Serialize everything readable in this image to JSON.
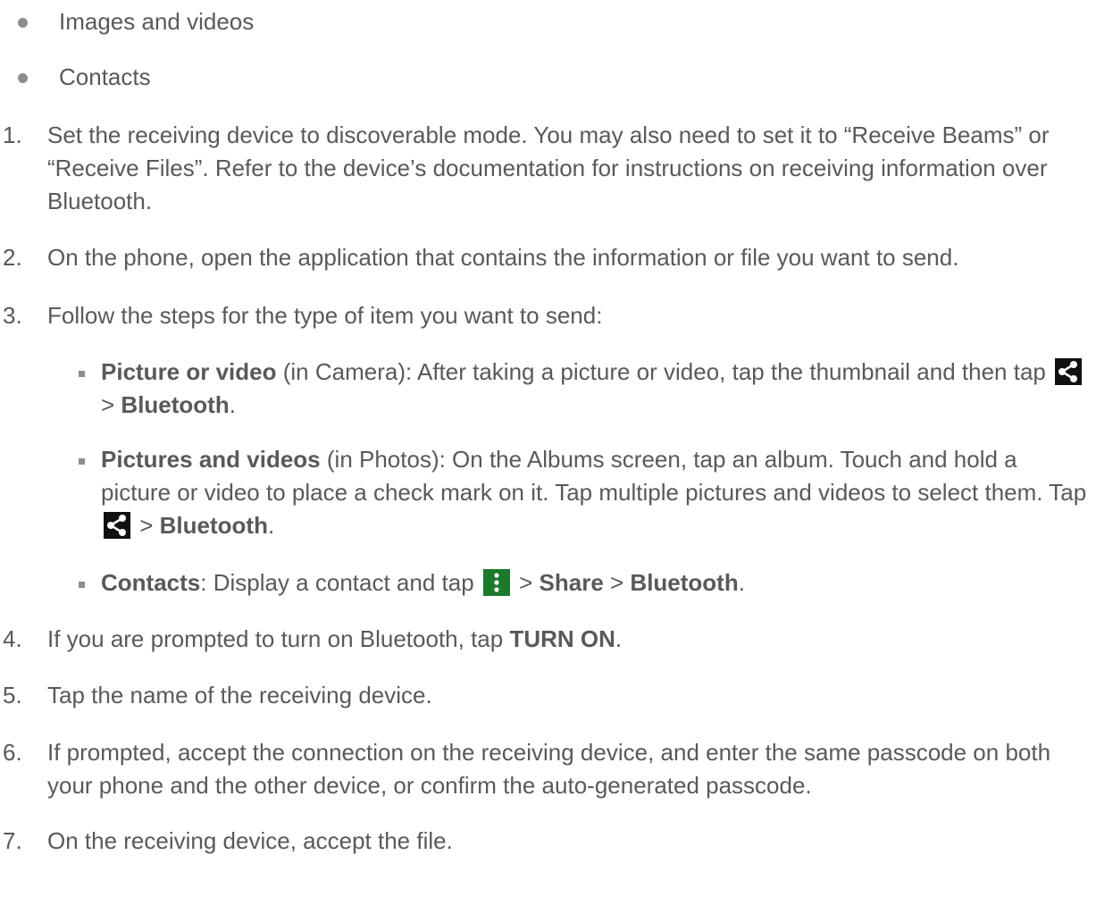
{
  "bullets": [
    "Images and videos",
    "Contacts"
  ],
  "steps": [
    {
      "num": "1.",
      "text": "Set the receiving device to discoverable mode. You may also need to set it to “Receive Beams” or “Receive Files”. Refer to the device’s documentation for instructions on receiving information over Bluetooth."
    },
    {
      "num": "2.",
      "text": "On the phone, open the application that contains the information or file you want to send."
    },
    {
      "num": "3.",
      "text": "Follow the steps for the type of item you want to send:"
    },
    {
      "num": "4.",
      "pre": "If you are prompted to turn on Bluetooth, tap ",
      "bold": "TURN ON",
      "post": "."
    },
    {
      "num": "5.",
      "text": "Tap the name of the receiving device."
    },
    {
      "num": "6.",
      "text": "If prompted, accept the connection on the receiving device, and enter the same passcode on both your phone and the other device, or confirm the auto-generated passcode."
    },
    {
      "num": "7.",
      "text": "On the receiving device, accept the file."
    }
  ],
  "subitems": {
    "picture": {
      "bold": "Picture or video",
      "text": " (in Camera): After taking a picture or video, tap the thumbnail and then tap ",
      "gt": " > ",
      "target": "Bluetooth",
      "end": "."
    },
    "pictures": {
      "bold": "Pictures and videos",
      "text": " (in Photos): On the Albums screen, tap an album. Touch and hold a picture or video to place a check mark on it. Tap multiple pictures and videos to select them. Tap ",
      "gt": " > ",
      "target": "Bluetooth",
      "end": "."
    },
    "contacts": {
      "bold": "Contacts",
      "text": ": Display a contact and tap ",
      "gt1": " > ",
      "share": "Share",
      "gt2": " > ",
      "target": "Bluetooth",
      "end": "."
    }
  },
  "icons": {
    "share": "share-icon",
    "menu": "more-vert-icon"
  },
  "colors": {
    "text": "#595959",
    "share_icon_bg": "#111111",
    "menu_icon_bg": "#1c7a2c"
  }
}
